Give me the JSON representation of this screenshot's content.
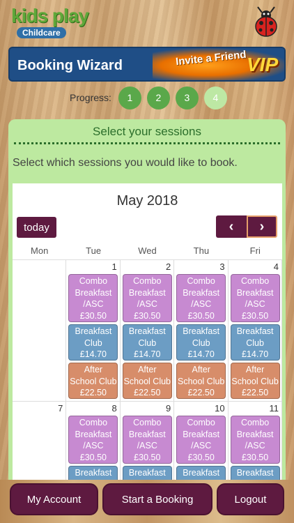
{
  "logo": {
    "main": "kids play",
    "sub": "Childcare"
  },
  "banner": {
    "title": "Booking Wizard",
    "invite": "Invite a Friend",
    "vip": "VIP"
  },
  "progress": {
    "label": "Progress:",
    "steps": [
      "1",
      "2",
      "3",
      "4"
    ]
  },
  "panel": {
    "title": "Select your sessions",
    "instructions": "Select which sessions you would like to book."
  },
  "calendar": {
    "month": "May 2018",
    "today_label": "today",
    "prev_glyph": "‹",
    "next_glyph": "›",
    "weekdays": [
      "Mon",
      "Tue",
      "Wed",
      "Thu",
      "Fri"
    ],
    "week1": {
      "days": [
        "",
        "1",
        "2",
        "3",
        "4"
      ]
    },
    "week2": {
      "days": [
        "7",
        "8",
        "9",
        "10",
        "11"
      ]
    },
    "sessions": {
      "combo": {
        "line1": "Combo",
        "line2": "Breakfast",
        "line3": "/ASC",
        "price": "£30.50"
      },
      "breakfast": {
        "line1": "Breakfast",
        "line2": "Club",
        "price": "£14.70"
      },
      "asc": {
        "line1": "After",
        "line2": "School Club",
        "price": "£22.50"
      }
    }
  },
  "footer": {
    "my_account": "My Account",
    "start_booking": "Start a Booking",
    "logout": "Logout"
  },
  "colors": {
    "accent": "#5e1a40",
    "green": "#5aa84a",
    "panel": "#bde9a0",
    "combo": "#c78ad1",
    "breakfast": "#6c9dc4",
    "after_school": "#d78d6a"
  }
}
